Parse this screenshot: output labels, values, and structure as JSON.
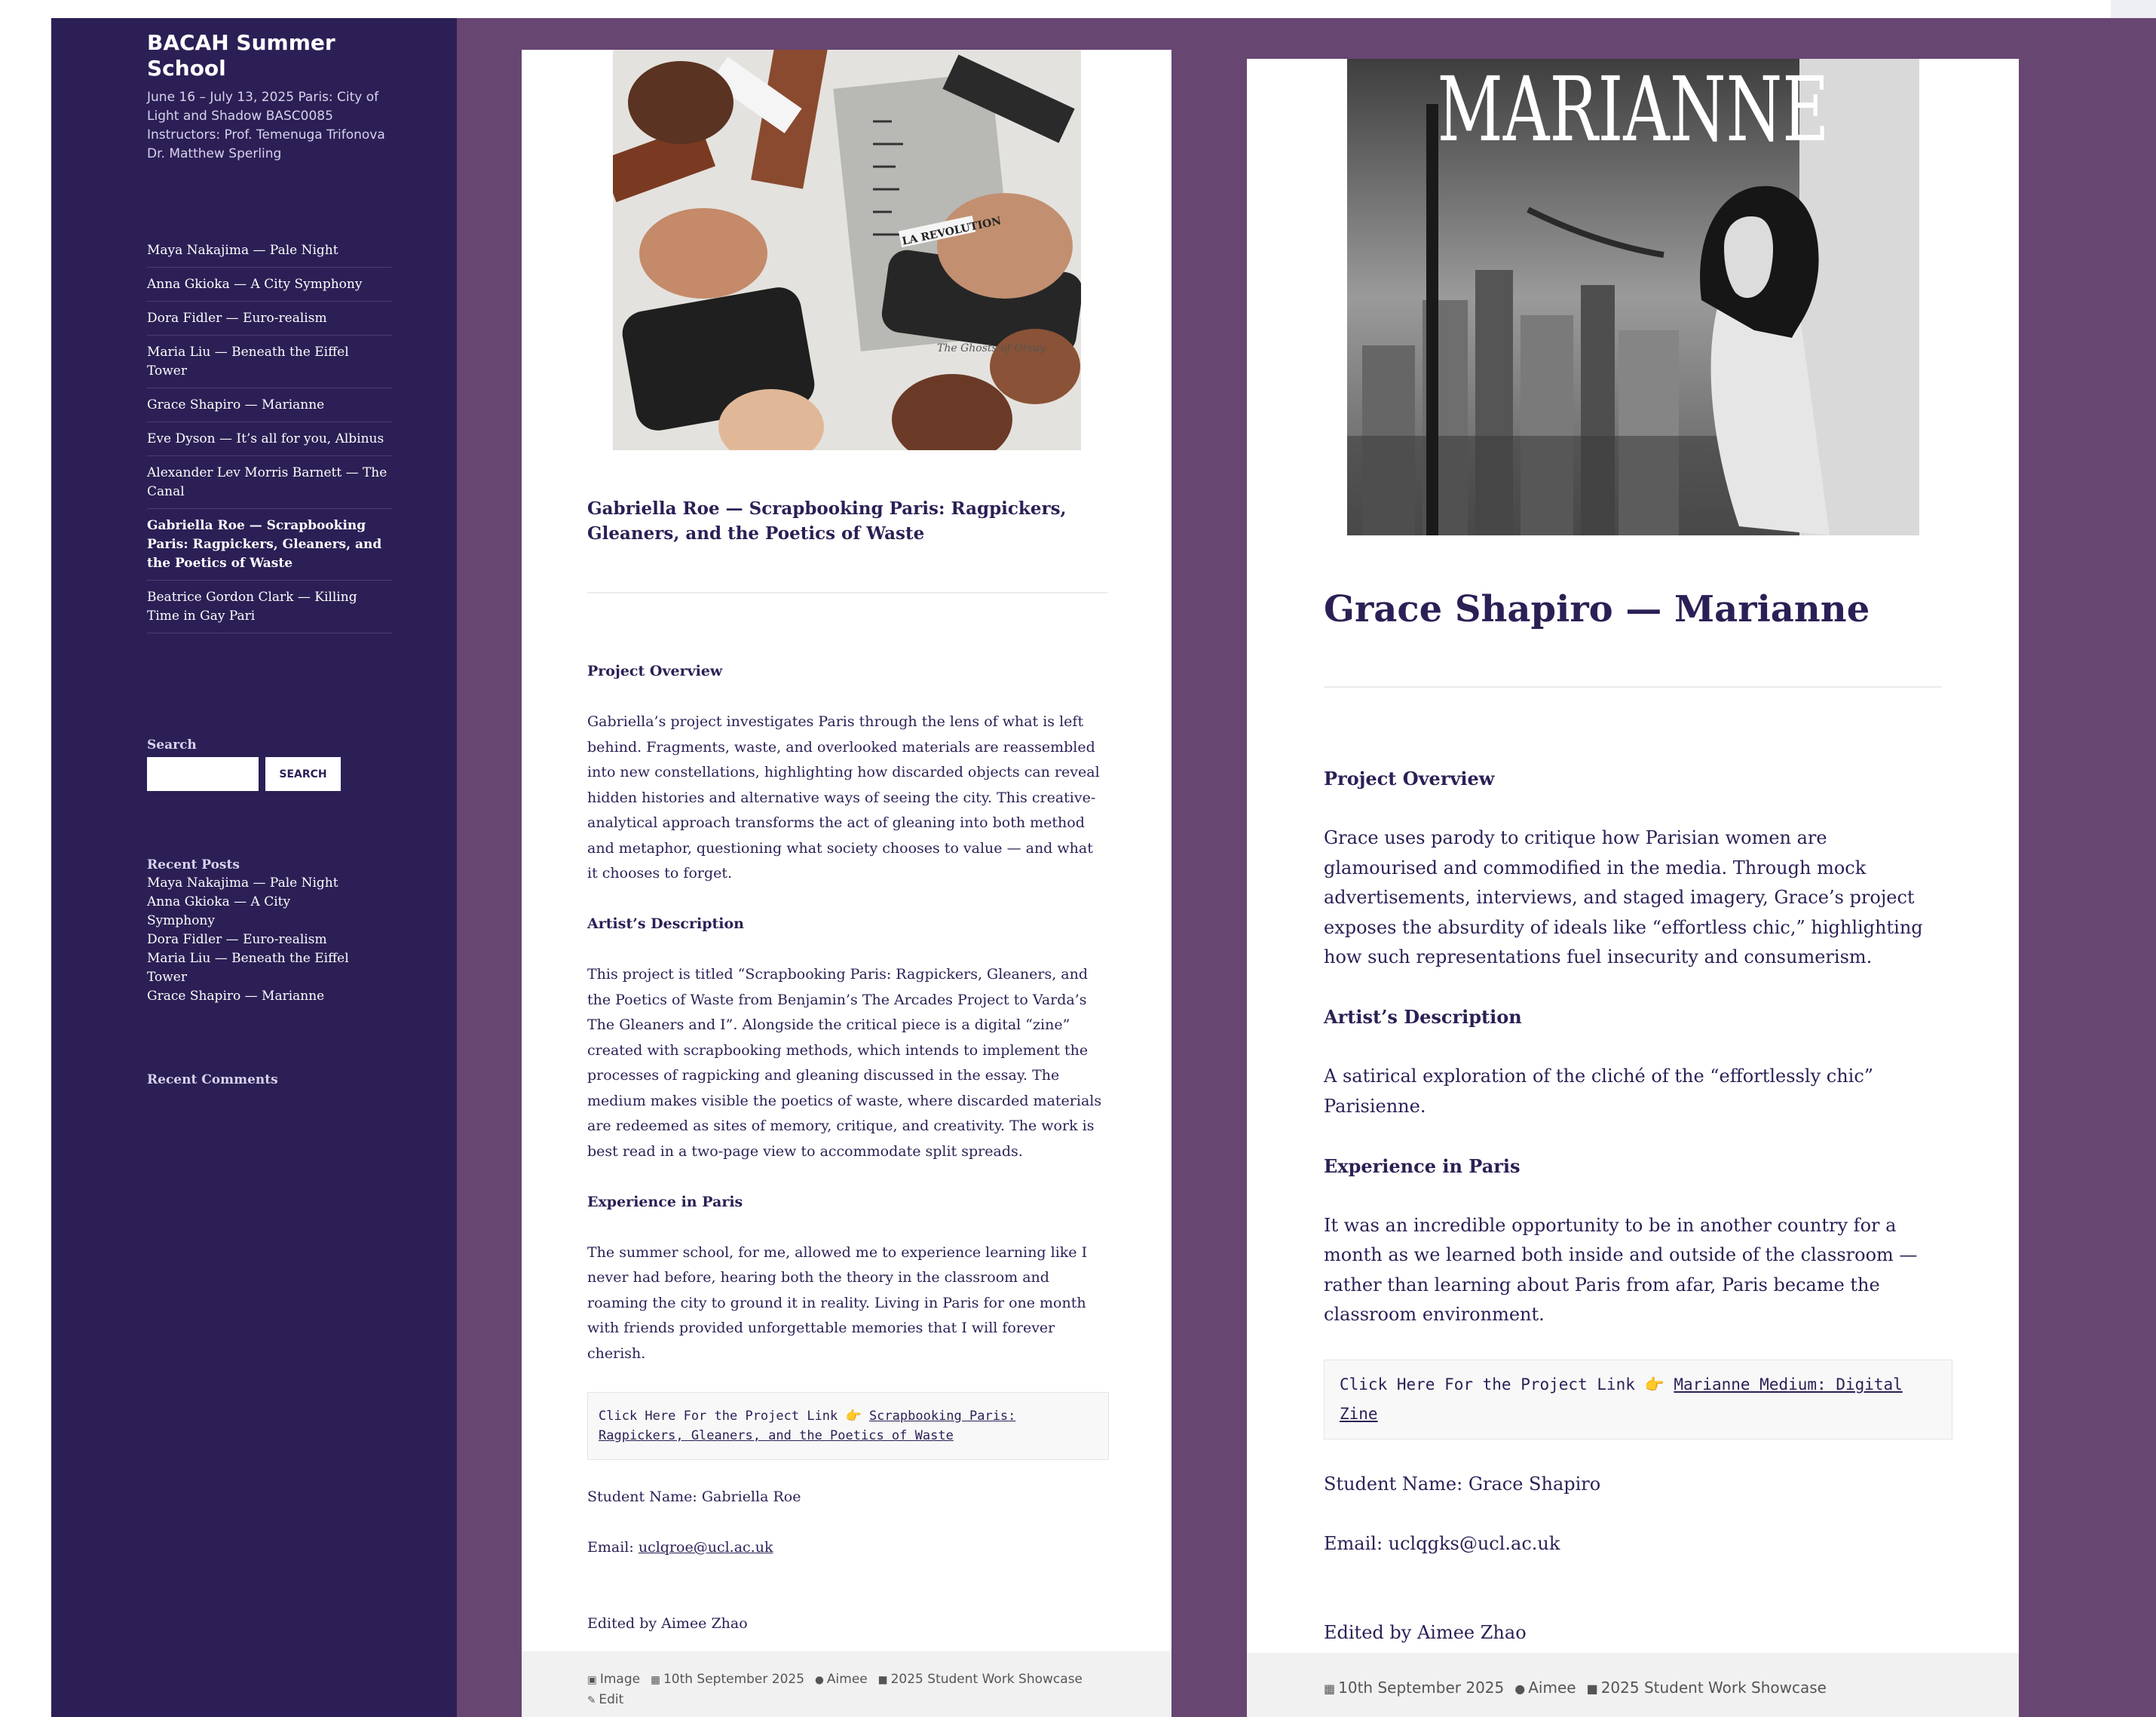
{
  "site": {
    "title": "BACAH Summer School",
    "description": "June 16 – July 13, 2025 Paris: City of Light and Shadow BASC0085 Instructors: Prof. Temenuga Trifonova Dr. Matthew Sperling"
  },
  "nav": [
    {
      "label": "Maya Nakajima — Pale Night",
      "current": false
    },
    {
      "label": "Anna Gkioka — A City Symphony",
      "current": false
    },
    {
      "label": "Dora Fidler — Euro-realism",
      "current": false
    },
    {
      "label": "Maria Liu — Beneath the Eiffel Tower",
      "current": false
    },
    {
      "label": "Grace Shapiro — Marianne",
      "current": false
    },
    {
      "label": "Eve Dyson — It’s all for you, Albinus",
      "current": false
    },
    {
      "label": "Alexander Lev Morris Barnett — The Canal",
      "current": false
    },
    {
      "label": "Gabriella Roe — Scrapbooking Paris: Ragpickers, Gleaners, and the Poetics of Waste",
      "current": true
    },
    {
      "label": "Beatrice Gordon Clark — Killing Time in Gay Pari",
      "current": false
    }
  ],
  "search": {
    "title": "Search",
    "button": "SEARCH"
  },
  "recent_posts": {
    "title": "Recent Posts",
    "items": [
      "Maya Nakajima — Pale Night",
      "Anna Gkioka — A City Symphony",
      "Dora Fidler — Euro-realism",
      "Maria Liu — Beneath the Eiffel Tower",
      "Grace Shapiro — Marianne"
    ]
  },
  "recent_comments": {
    "title": "Recent Comments"
  },
  "post1": {
    "title": "Gabriella Roe — Scrapbooking Paris: Ragpickers, Gleaners, and the Poetics of Waste",
    "overview_heading": "Project Overview",
    "overview": "Gabriella’s project investigates Paris through the lens of what is left behind. Fragments, waste, and overlooked materials are reassembled into new constellations, highlighting how discarded objects can reveal hidden histories and alternative ways of seeing the city. This creative-analytical approach transforms the act of gleaning into both method and metaphor, questioning what society chooses to value — and what it chooses to forget.",
    "artist_heading": "Artist’s Description",
    "artist": "This project is titled “Scrapbooking Paris: Ragpickers, Gleaners, and the Poetics of Waste from Benjamin’s The Arcades Project to Varda’s The Gleaners and I”. Alongside the critical piece is a digital “zine” created with scrapbooking methods, which intends to implement the processes of ragpicking and gleaning discussed in the essay. The medium makes visible the poetics of waste, where discarded materials are redeemed as sites of memory, critique, and creativity. The work is best read in a two-page view to accommodate split spreads.",
    "experience_heading": "Experience in Paris",
    "experience": "The summer school, for me, allowed me to experience learning like I never had before, hearing both the theory in the classroom and roaming the city to ground it in reality. Living in Paris for one month with friends provided unforgettable memories that I will forever cherish.",
    "link_prefix": "Click Here For the Project Link 👉",
    "link_text": "Scrapbooking Paris: Ragpickers, Gleaners, and the Poetics of Waste",
    "student": "Student Name: Gabriella Roe",
    "email_label": "Email:",
    "email": "uclqroe@ucl.ac.uk",
    "edited": "Edited by Aimee Zhao",
    "footer": {
      "format": "Image",
      "date": "10th September 2025",
      "author": "Aimee",
      "category": "2025 Student Work Showcase",
      "edit": "Edit"
    },
    "image_words": {
      "a": "LA REVOLUTION",
      "b": "The Ghosts of Orsay"
    }
  },
  "post2": {
    "masthead": "MARIANNE",
    "title": "Grace Shapiro — Marianne",
    "overview_heading": "Project Overview",
    "overview": "Grace uses parody to critique how Parisian women are glamourised and commodified in the media. Through mock advertisements, interviews, and staged imagery, Grace’s project exposes the absurdity of ideals like “effortless chic,” highlighting how such representations fuel insecurity and consumerism.",
    "artist_heading": "Artist’s Description",
    "artist": "A satirical exploration of the cliché of the “effortlessly chic” Parisienne.",
    "experience_heading": "Experience in Paris",
    "experience": "It was an incredible opportunity to be in another country for a month as we learned both inside and outside of the classroom — rather than learning about Paris from afar, Paris became the classroom environment.",
    "link_prefix": "Click Here For the Project Link 👉",
    "link_text": "Marianne Medium: Digital Zine",
    "student": "Student Name: Grace Shapiro",
    "email": "Email: uclqgks@ucl.ac.uk",
    "edited": "Edited by Aimee Zhao",
    "footer": {
      "date": "10th September 2025",
      "author": "Aimee",
      "category": "2025 Student Work Showcase"
    }
  }
}
